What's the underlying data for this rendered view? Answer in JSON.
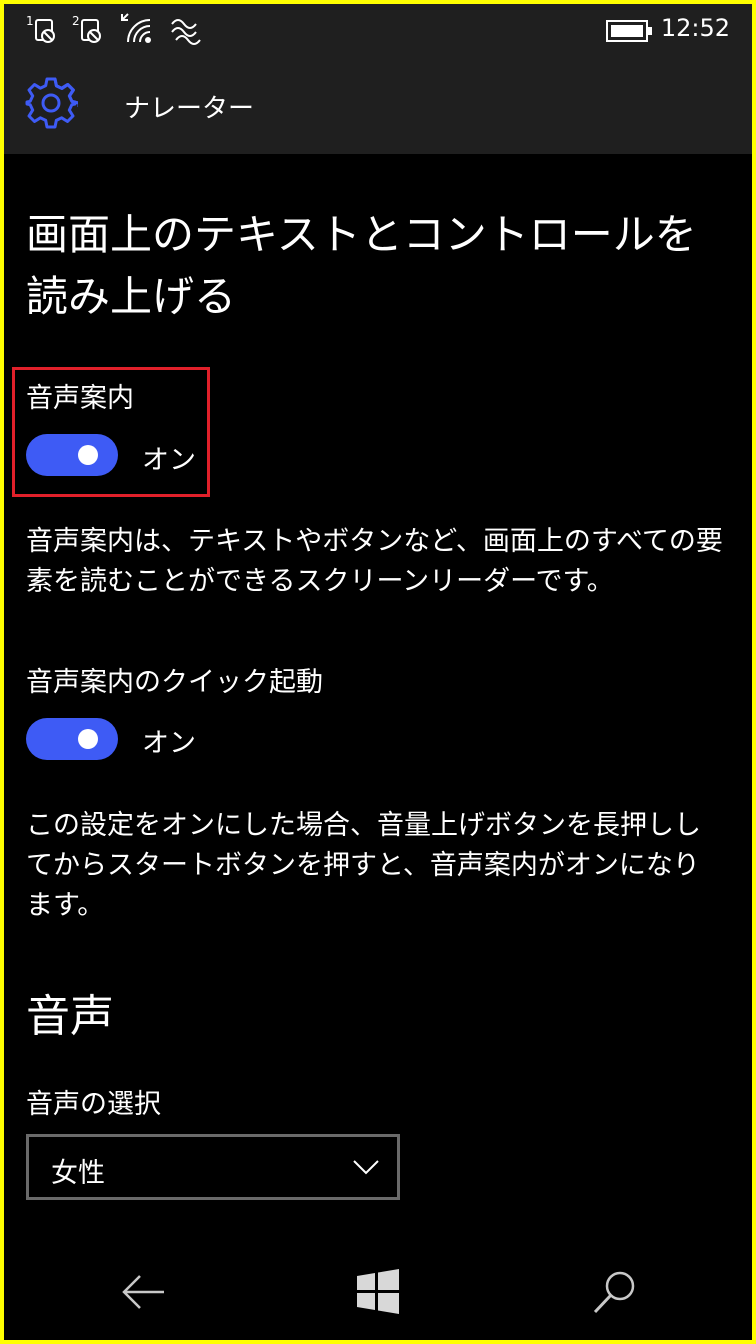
{
  "status": {
    "sim1_label": "1",
    "sim2_label": "2",
    "time": "12:52",
    "icons": [
      "sim1-no-signal-icon",
      "sim2-no-signal-icon",
      "wifi-icon",
      "vibrate-icon",
      "battery-icon"
    ]
  },
  "header": {
    "title": "ナレーター",
    "icon": "gear-icon",
    "accent_color": "#3e5bf5"
  },
  "main": {
    "page_title": "画面上のテキストとコントロールを読み上げる",
    "narrator": {
      "label": "音声案内",
      "toggle_state": "オン",
      "is_on": true,
      "description": "音声案内は、テキストやボタンなど、画面上のすべての要素を読むことができるスクリーンリーダーです。"
    },
    "quick_launch": {
      "label": "音声案内のクイック起動",
      "toggle_state": "オン",
      "is_on": true,
      "description": "この設定をオンにした場合、音量上げボタンを長押ししてからスタートボタンを押すと、音声案内がオンになります。"
    },
    "voice_section": {
      "title": "音声",
      "select_label": "音声の選択",
      "selected_value": "女性"
    }
  },
  "colors": {
    "toggle_on": "#3e5bf5",
    "highlight_border": "#e0202a",
    "frame_border": "#ffff00",
    "bar_background": "#1f1f1f"
  },
  "navbar": {
    "icons": [
      "back-arrow-icon",
      "windows-start-icon",
      "search-icon"
    ]
  }
}
